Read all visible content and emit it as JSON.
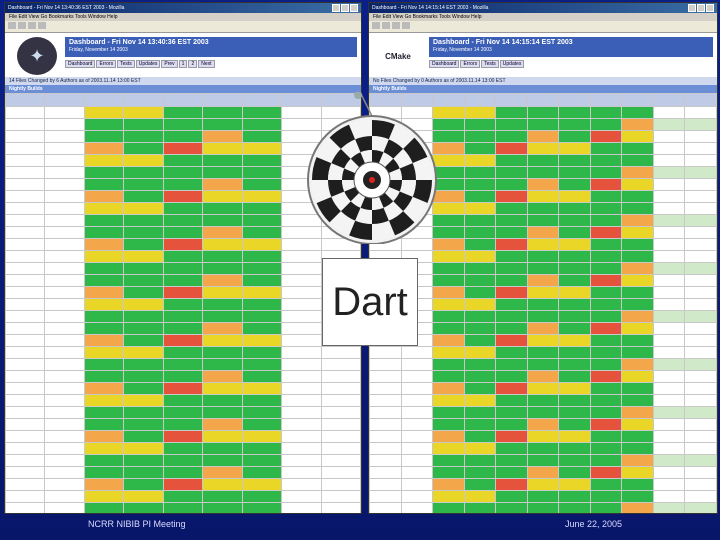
{
  "left_window": {
    "title": "Dashboard - Fri Nov 14 13:40:36 EST 2003 - Mozilla",
    "menu": "File  Edit  View  Go  Bookmarks  Tools  Window  Help",
    "dashboard_title": "Dashboard - Fri Nov 14 13:40:36 EST 2003",
    "dashboard_subtitle": "Friday, November 14 2003",
    "tabs": [
      "Dashboard",
      "Errors",
      "Tests",
      "Updates",
      "Prev",
      "1",
      "2",
      "Next"
    ],
    "changes_bar": "14 Files Changed by 6 Authors as of 2003.11.14 13:00 EST",
    "section": "Nightly Builds"
  },
  "right_window": {
    "title": "Dashboard - Fri Nov 14 14:15:14 EST 2003 - Mozilla",
    "menu": "File  Edit  View  Go  Bookmarks  Tools  Window  Help",
    "logo_text": "CMake",
    "dashboard_title": "Dashboard - Fri Nov 14 14:15:14 EST 2003",
    "dashboard_subtitle": "Friday, November 14 2003",
    "tabs": [
      "Dashboard",
      "Errors",
      "Tests",
      "Updates"
    ],
    "changes_bar": "No Files Changed by 0 Authors as of 2003.11.14 13:00 EST",
    "section": "Nightly Builds"
  },
  "overlay": {
    "label": "Dart"
  },
  "footer": {
    "left": "NCRR NIBIB PI Meeting",
    "right": "June 22, 2005"
  },
  "colors": {
    "background": "#0b1f88",
    "pass": "#2fb84a",
    "warn": "#e9d626",
    "fail": "#e5533d",
    "header": "#3b5fb6"
  }
}
